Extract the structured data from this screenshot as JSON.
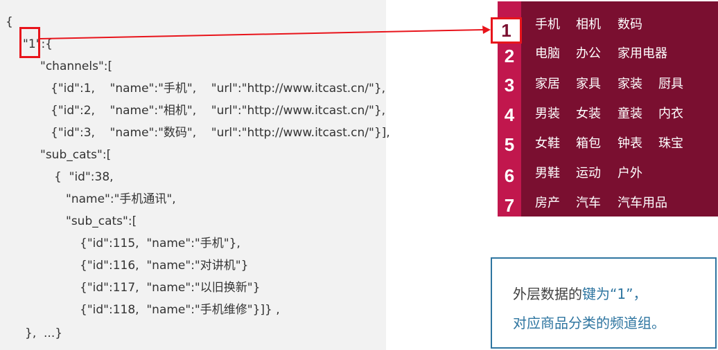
{
  "code": {
    "lines": [
      "{",
      "\"1\":{",
      "\"channels\":[",
      "{\"id\":1,    \"name\":\"手机\",    \"url\":\"http://www.itcast.cn/\"},",
      "{\"id\":2,    \"name\":\"相机\",    \"url\":\"http://www.itcast.cn/\"},",
      "{\"id\":3,    \"name\":\"数码\",    \"url\":\"http://www.itcast.cn/\"}],",
      "\"sub_cats\":[",
      "{  \"id\":38,",
      "\"name\":\"手机通讯\",",
      "\"sub_cats\":[",
      "{\"id\":115,  \"name\":\"手机\"},",
      "{\"id\":116,  \"name\":\"对讲机\"}",
      "{\"id\":117,  \"name\":\"以旧换新\"}",
      "{\"id\":118,  \"name\":\"手机维修\"}]} ,",
      "},  ...}"
    ]
  },
  "menu": {
    "rows": [
      {
        "num": "1",
        "items": [
          "手机",
          "相机",
          "数码"
        ]
      },
      {
        "num": "2",
        "items": [
          "电脑",
          "办公",
          "家用电器"
        ]
      },
      {
        "num": "3",
        "items": [
          "家居",
          "家具",
          "家装",
          "厨具"
        ]
      },
      {
        "num": "4",
        "items": [
          "男装",
          "女装",
          "童装",
          "内衣"
        ]
      },
      {
        "num": "5",
        "items": [
          "女鞋",
          "箱包",
          "钟表",
          "珠宝"
        ]
      },
      {
        "num": "6",
        "items": [
          "男鞋",
          "运动",
          "户外"
        ]
      },
      {
        "num": "7",
        "items": [
          "房产",
          "汽车",
          "汽车用品"
        ]
      }
    ]
  },
  "note": {
    "line1_prefix": "外层数据的",
    "line1_highlight": "键为“1”，",
    "line2": "对应商品分类的频道组。"
  },
  "colors": {
    "highlight_red": "#e8141b",
    "menu_bg": "#7a0f30",
    "menu_num_bg": "#c1174d",
    "note_border": "#2e75a0",
    "note_blue_text": "#2e75a0"
  }
}
